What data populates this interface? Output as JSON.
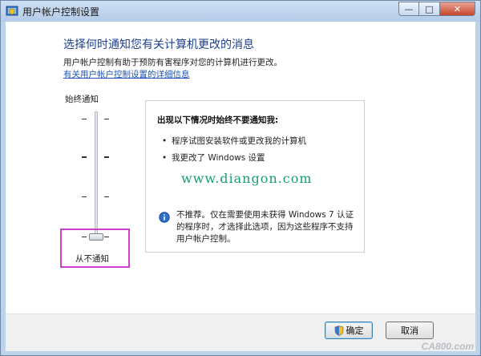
{
  "window": {
    "title": "用户帐户控制设置",
    "controls": {
      "minimize": "—",
      "maximize": "□",
      "close": "✕"
    }
  },
  "main": {
    "heading": "选择何时通知您有关计算机更改的消息",
    "description": "用户帐户控制有助于预防有害程序对您的计算机进行更改。",
    "link": "有关用户帐户控制设置的详细信息"
  },
  "slider": {
    "top_label": "始终通知",
    "bottom_label": "从不通知",
    "level_count": 4,
    "selected_level": 0,
    "highlight_color": "#d040c8"
  },
  "info_panel": {
    "title": "出现以下情况时始终不要通知我:",
    "bullets": [
      "程序试图安装软件或更改我的计算机",
      "我更改了 Windows 设置"
    ],
    "watermark_url": "www.diangon.com",
    "note": "不推荐。仅在需要使用未获得 Windows 7 认证的程序时，才选择此选项，因为这些程序不支持用户帐户控制。"
  },
  "footer": {
    "ok_label": "确定",
    "cancel_label": "取消"
  },
  "corner_watermark": "CA800.com",
  "colors": {
    "heading": "#1e3f8e",
    "link": "#1f55b4",
    "watermark": "#17a06a"
  },
  "icons": {
    "title": "uac-shield-icon",
    "info": "info-icon",
    "ok_button": "uac-shield-icon"
  }
}
